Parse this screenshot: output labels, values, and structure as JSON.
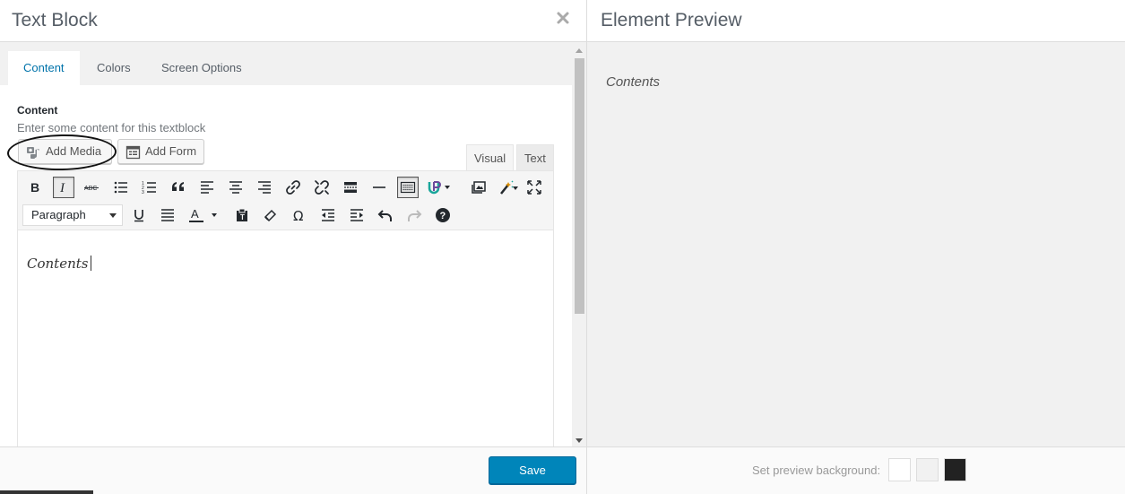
{
  "left_panel": {
    "title": "Text Block",
    "tabs": [
      {
        "label": "Content",
        "active": true
      },
      {
        "label": "Colors",
        "active": false
      },
      {
        "label": "Screen Options",
        "active": false
      }
    ],
    "field": {
      "label": "Content",
      "description": "Enter some content for this textblock"
    },
    "buttons": {
      "add_media": "Add Media",
      "add_form": "Add Form"
    },
    "editor_modes": {
      "visual": "Visual",
      "text": "Text",
      "active": "visual"
    },
    "toolbar": {
      "format_select": "Paragraph",
      "row1_icons": [
        "bold-icon",
        "italic-icon",
        "strikethrough-icon",
        "bullet-list-icon",
        "numbered-list-icon",
        "blockquote-icon",
        "align-left-icon",
        "align-center-icon",
        "align-right-icon",
        "link-icon",
        "unlink-icon",
        "read-more-icon",
        "horizontal-line-icon",
        "toolbar-toggle-icon",
        "shortcode-icon",
        "insert-media-icon",
        "magic-wand-icon",
        "fullscreen-icon"
      ],
      "row2_icons": [
        "underline-icon",
        "justify-icon",
        "text-color-icon",
        "paste-text-icon",
        "clear-formatting-icon",
        "special-character-icon",
        "outdent-icon",
        "indent-icon",
        "undo-icon",
        "redo-icon",
        "help-icon"
      ]
    },
    "editor_content": "Contents",
    "save_label": "Save"
  },
  "right_panel": {
    "title": "Element Preview",
    "preview_content": "Contents",
    "background_label": "Set preview background:",
    "swatches": [
      "#ffffff",
      "#f1f1f1",
      "#222222"
    ]
  },
  "colors": {
    "accent": "#0073aa",
    "save_button": "#0085ba"
  }
}
